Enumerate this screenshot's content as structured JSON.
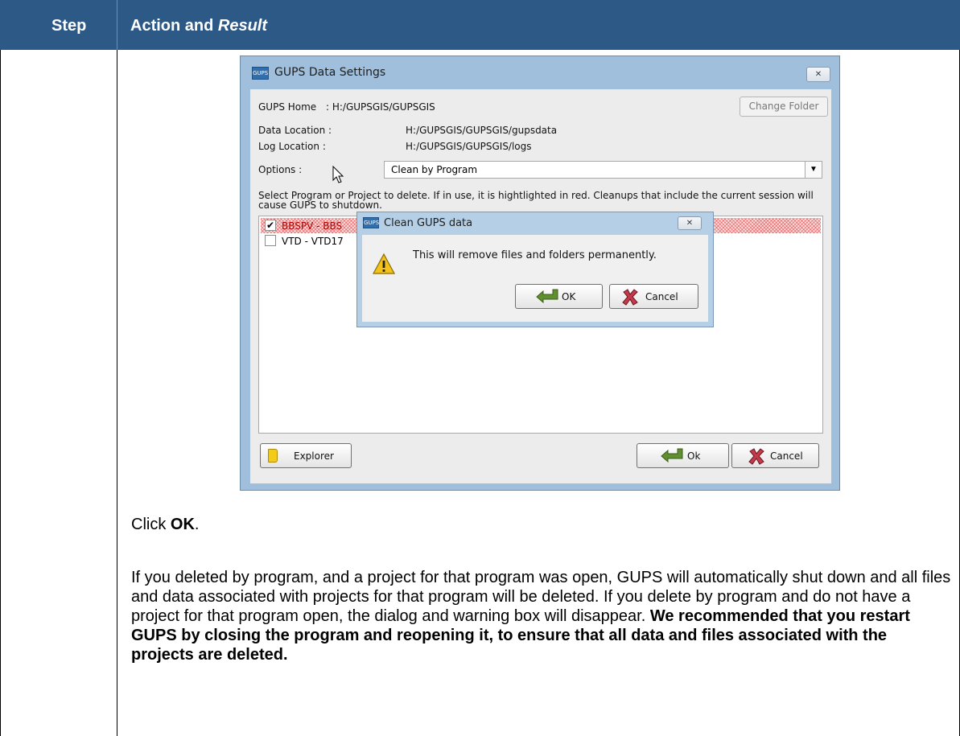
{
  "table_header": {
    "step": "Step",
    "action": "Action and ",
    "result": "Result"
  },
  "dialog": {
    "title": "GUPS Data Settings",
    "icon_text": "GUPS",
    "close_label": "✕",
    "gups_home_label": "GUPS Home",
    "gups_home_value": ": H:/GUPSGIS/GUPSGIS",
    "change_folder_label": "Change Folder",
    "data_location_label": "Data Location :",
    "data_location_value": "H:/GUPSGIS/GUPSGIS/gupsdata",
    "log_location_label": "Log Location :",
    "log_location_value": "H:/GUPSGIS/GUPSGIS/logs",
    "options_label": "Options :",
    "options_selected": "Clean by Program",
    "description": "Select Program or Project to delete. If in use, it is hightlighted in red. Cleanups that include the current session will cause GUPS to shutdown.",
    "list_items": [
      {
        "label": "BBSPV - BBS",
        "checked": true,
        "highlighted": true
      },
      {
        "label": "VTD - VTD17",
        "checked": false,
        "highlighted": false
      }
    ],
    "explorer_label": "Explorer",
    "ok_label": "Ok",
    "cancel_label": "Cancel"
  },
  "modal": {
    "title": "Clean GUPS data",
    "icon_text": "GUPS",
    "close_label": "✕",
    "message": "This will remove files and folders permanently.",
    "ok_label": "OK",
    "cancel_label": "Cancel",
    "icon": "warning-icon"
  },
  "instructions": {
    "click_prefix": "Click ",
    "click_target": "OK",
    "click_suffix": ".",
    "paragraph": "If you deleted by program, and a project for that program was open, GUPS will automatically shut down and all files and data associated with projects for that program will be deleted. If you delete by program and do not have a project for that program open, the dialog and warning box will disappear. ",
    "recommendation": "We recommended that you restart GUPS by closing the program and reopening it, to ensure that all data and files associated with the projects are deleted."
  },
  "colors": {
    "header_bg": "#2c5986",
    "dialog_frame": "#9fbfdc",
    "highlight_red": "#b00000"
  }
}
